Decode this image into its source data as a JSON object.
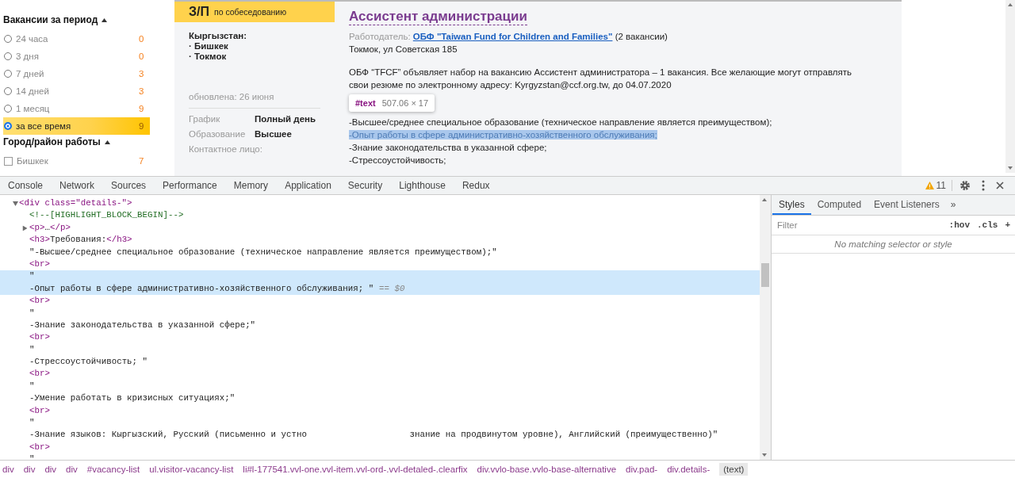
{
  "filters": [
    {
      "title": "Вакансии за период",
      "kind": "radio",
      "expanded": true,
      "options": [
        {
          "label": "24 часа",
          "count": "0",
          "selected": false
        },
        {
          "label": "3 дня",
          "count": "0",
          "selected": false
        },
        {
          "label": "7 дней",
          "count": "3",
          "selected": false
        },
        {
          "label": "14 дней",
          "count": "3",
          "selected": false
        },
        {
          "label": "1 месяц",
          "count": "9",
          "selected": false
        },
        {
          "label": "за все время",
          "count": "9",
          "selected": true
        }
      ]
    },
    {
      "title": "Город/район работы",
      "kind": "checkbox",
      "expanded": true,
      "options": [
        {
          "label": "Бишкек",
          "count": "7",
          "checked": false
        }
      ]
    }
  ],
  "card": {
    "salary": {
      "label": "З/П",
      "note": "по собеседованию"
    },
    "country": "Кыргызстан:",
    "cities": [
      "· Бишкек",
      "· Токмок"
    ],
    "updated": "обновлена: 26 июня",
    "details": [
      {
        "label": "График",
        "value": "Полный день"
      },
      {
        "label": "Образование",
        "value": "Высшее"
      }
    ],
    "contact_label": "Контактное лицо:"
  },
  "vacancy": {
    "title": "Ассистент администрации",
    "employer_label": "Работодатель:",
    "employer": "ОБФ \"Taiwan Fund for Children and Families\"",
    "employer_note": "(2 вакансии)",
    "address": "Токмок, ул Советская 185",
    "description": "ОБФ “TFCF” объявляет набор на вакансию Ассистент администратора – 1 вакансия. Все желающие могут отправлять свои резюме по электронному адресу: Kyrgyzstan@ccf.org.tw, до 04.07.2020",
    "requirements": [
      {
        "text": "-Высшее/среднее специальное образование (техническое направление является преимуществом);",
        "highlighted": false
      },
      {
        "text": "-Опыт работы в сфере административно-хозяйственного обслуживания;",
        "highlighted": true
      },
      {
        "text": "-Знание законодательства в указанной сфере;",
        "highlighted": false
      },
      {
        "text": "-Стрессоустойчивость;",
        "highlighted": false
      }
    ],
    "tooltip": {
      "node": "#text",
      "size": "507.06 × 17"
    }
  },
  "devtools": {
    "tabs": [
      "Console",
      "Network",
      "Sources",
      "Performance",
      "Memory",
      "Application",
      "Security",
      "Lighthouse",
      "Redux"
    ],
    "warnings": "11",
    "root": {
      "expanded": true,
      "open": "<div class=\"details-\">",
      "selected": false,
      "children": [
        {
          "kind": "comment",
          "text": "<!--[HIGHLIGHT_BLOCK_BEGIN]-->",
          "selected": false
        },
        {
          "kind": "element",
          "expanded": false,
          "open": "<p>",
          "content": "…",
          "close": "</p>",
          "selected": false
        },
        {
          "kind": "element",
          "open": "<h3>",
          "content": "Требования:",
          "close": "</h3>",
          "selected": false
        },
        {
          "kind": "text",
          "text": "\"-Высшее/среднее специальное образование (техническое направление является преимуществом);\"",
          "selected": false
        },
        {
          "kind": "element",
          "open": "<br>",
          "selected": false
        },
        {
          "kind": "text",
          "text": "\"",
          "selected": true
        },
        {
          "kind": "text",
          "text": "-Опыт работы в сфере административно-хозяйственного обслуживания; \"",
          "marker": "== $0",
          "selected": true
        },
        {
          "kind": "element",
          "open": "<br>",
          "selected": false
        },
        {
          "kind": "text",
          "text": "\"",
          "selected": false
        },
        {
          "kind": "text",
          "text": "-Знание законодательства в указанной сфере;\"",
          "selected": false
        },
        {
          "kind": "element",
          "open": "<br>",
          "selected": false
        },
        {
          "kind": "text",
          "text": "\"",
          "selected": false
        },
        {
          "kind": "text",
          "text": "-Стрессоустойчивость; \"",
          "selected": false
        },
        {
          "kind": "element",
          "open": "<br>",
          "selected": false
        },
        {
          "kind": "text",
          "text": "\"",
          "selected": false
        },
        {
          "kind": "text",
          "text": "-Умение работать в кризисных ситуациях;\"",
          "selected": false
        },
        {
          "kind": "element",
          "open": "<br>",
          "selected": false
        },
        {
          "kind": "text",
          "text": "\"",
          "selected": false
        },
        {
          "kind": "text",
          "text": "-Знание языков: Кыргызский, Русский (письменно и устно                    знание на продвинутом уровне), Английский (преимущественно)\"",
          "selected": false
        },
        {
          "kind": "element",
          "open": "<br>",
          "selected": false
        },
        {
          "kind": "text",
          "text": "\"",
          "selected": false
        }
      ]
    },
    "breadcrumbs": [
      {
        "text": "div",
        "selected": false
      },
      {
        "text": "div",
        "selected": false
      },
      {
        "text": "div",
        "selected": false
      },
      {
        "text": "div",
        "selected": false
      },
      {
        "text": "#vacancy-list",
        "selected": false
      },
      {
        "text": "ul.visitor-vacancy-list",
        "selected": false
      },
      {
        "text": "li#l-177541.vvl-one.vvl-item.vvl-ord-.vvl-detaled-.clearfix",
        "selected": false
      },
      {
        "text": "div.vvlo-base.vvlo-base-alternative",
        "selected": false
      },
      {
        "text": "div.pad-",
        "selected": false
      },
      {
        "text": "div.details-",
        "selected": false
      },
      {
        "text": "(text)",
        "selected": true
      }
    ],
    "side_tabs": [
      {
        "label": "Styles",
        "selected": true
      },
      {
        "label": "Computed",
        "selected": false
      },
      {
        "label": "Event Listeners",
        "selected": false
      }
    ],
    "more": "»",
    "filter": {
      "placeholder": "Filter"
    },
    "filter_buttons": [
      ":hov",
      ".cls",
      "+"
    ],
    "empty": "No matching selector or style"
  }
}
